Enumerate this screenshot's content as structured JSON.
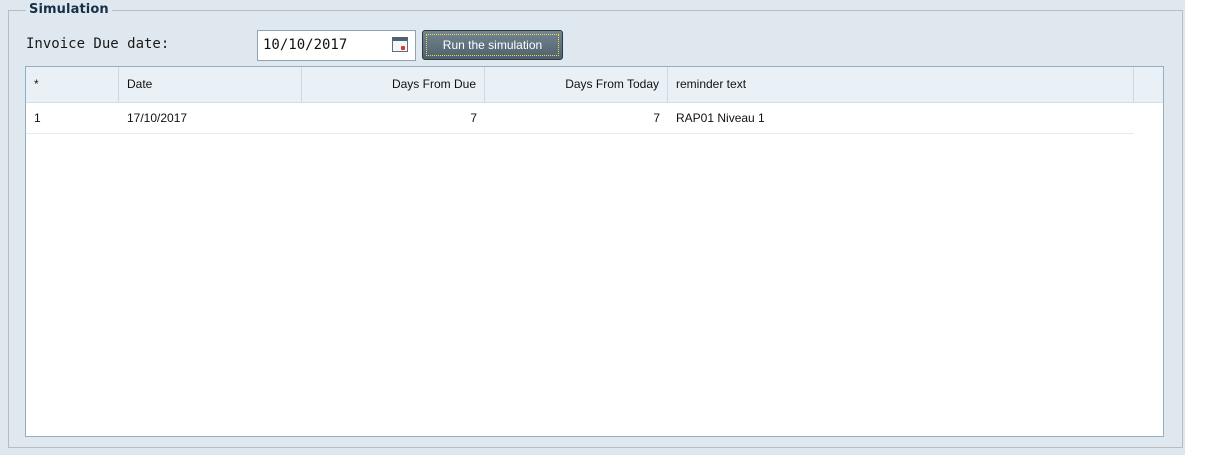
{
  "simulation": {
    "legend": "Simulation",
    "invoice_due_label": "Invoice Due date:",
    "invoice_due_value": "10/10/2017",
    "run_button_label": "Run the simulation"
  },
  "grid": {
    "columns": [
      "*",
      "Date",
      "Days From Due",
      "Days From Today",
      "reminder text"
    ],
    "rows": [
      {
        "index": "1",
        "date": "17/10/2017",
        "days_from_due": "7",
        "days_from_today": "7",
        "reminder_text": "RAP01 Niveau 1"
      }
    ]
  },
  "icons": {
    "calendar": "calendar-icon"
  },
  "colors": {
    "background": "#dfe8ee",
    "header_background": "#eaf1f6",
    "grid_border": "#93afc6",
    "button_background": "#5f717c",
    "button_focus": "#f2d94c"
  }
}
